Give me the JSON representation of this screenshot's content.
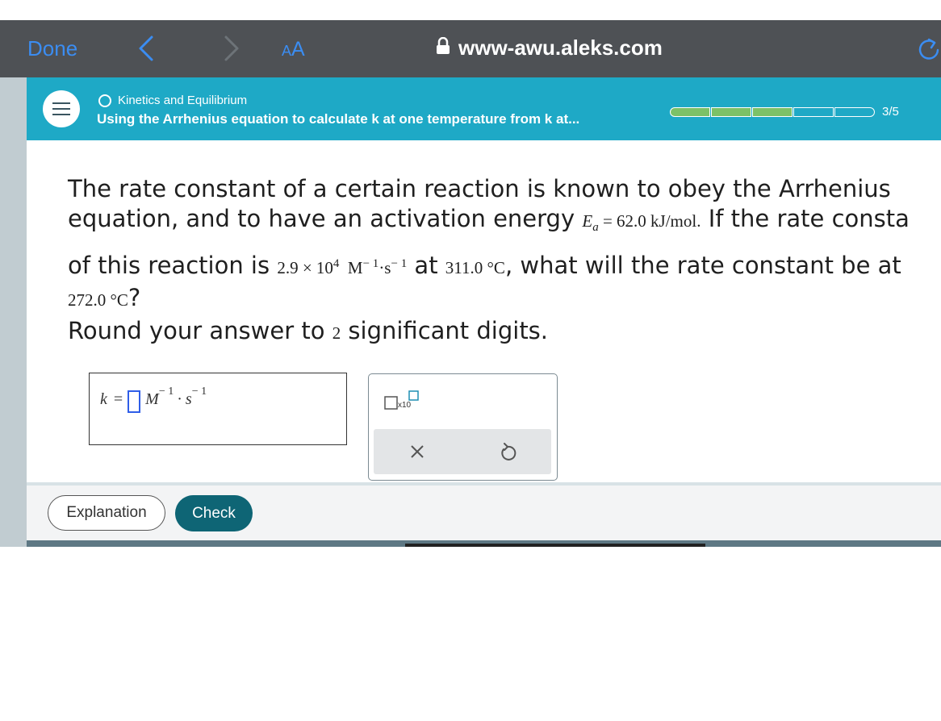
{
  "browser": {
    "done_label": "Done",
    "aa_small": "A",
    "aa_large": "A",
    "url": "www-awu.aleks.com",
    "accent_color": "#3b8df2"
  },
  "header": {
    "topic": "Kinetics and Equilibrium",
    "subtitle": "Using the Arrhenius equation to calculate k at one temperature from k at...",
    "progress": {
      "completed": 3,
      "total": 5,
      "label": "3/5"
    },
    "color": "#1ea9c6"
  },
  "question": {
    "p1": "The rate constant of a certain reaction is known to obey the Arrhenius",
    "p2": "equation, and to have an activation energy",
    "ea_symbol": "E",
    "ea_sub": "a",
    "ea_value": "= 62.0  kJ/mol.",
    "p3": "If the rate consta",
    "p4": "of this reaction is",
    "k_value": "2.9 × 10",
    "k_exp": "4",
    "k_unit_m": "M",
    "k_unit_m_exp": "− 1",
    "k_unit_s": "·s",
    "k_unit_s_exp": "− 1",
    "p5": "at",
    "t1": "311.0 °C",
    "p6": ", what will the rate constant be at",
    "t2": "272.0 °C",
    "p7": "?",
    "round_pre": "Round your answer to",
    "round_num": "2",
    "round_post": "significant digits."
  },
  "answer": {
    "k": "k",
    "eq": "=",
    "m": "M",
    "m_exp": "− 1",
    "dot": "·",
    "s": "s",
    "s_exp": "− 1"
  },
  "tools": {
    "x10_label": "x10",
    "clear_icon": "close-icon",
    "undo_icon": "undo-icon"
  },
  "footer": {
    "explanation_label": "Explanation",
    "check_label": "Check",
    "check_color": "#0e6575"
  }
}
